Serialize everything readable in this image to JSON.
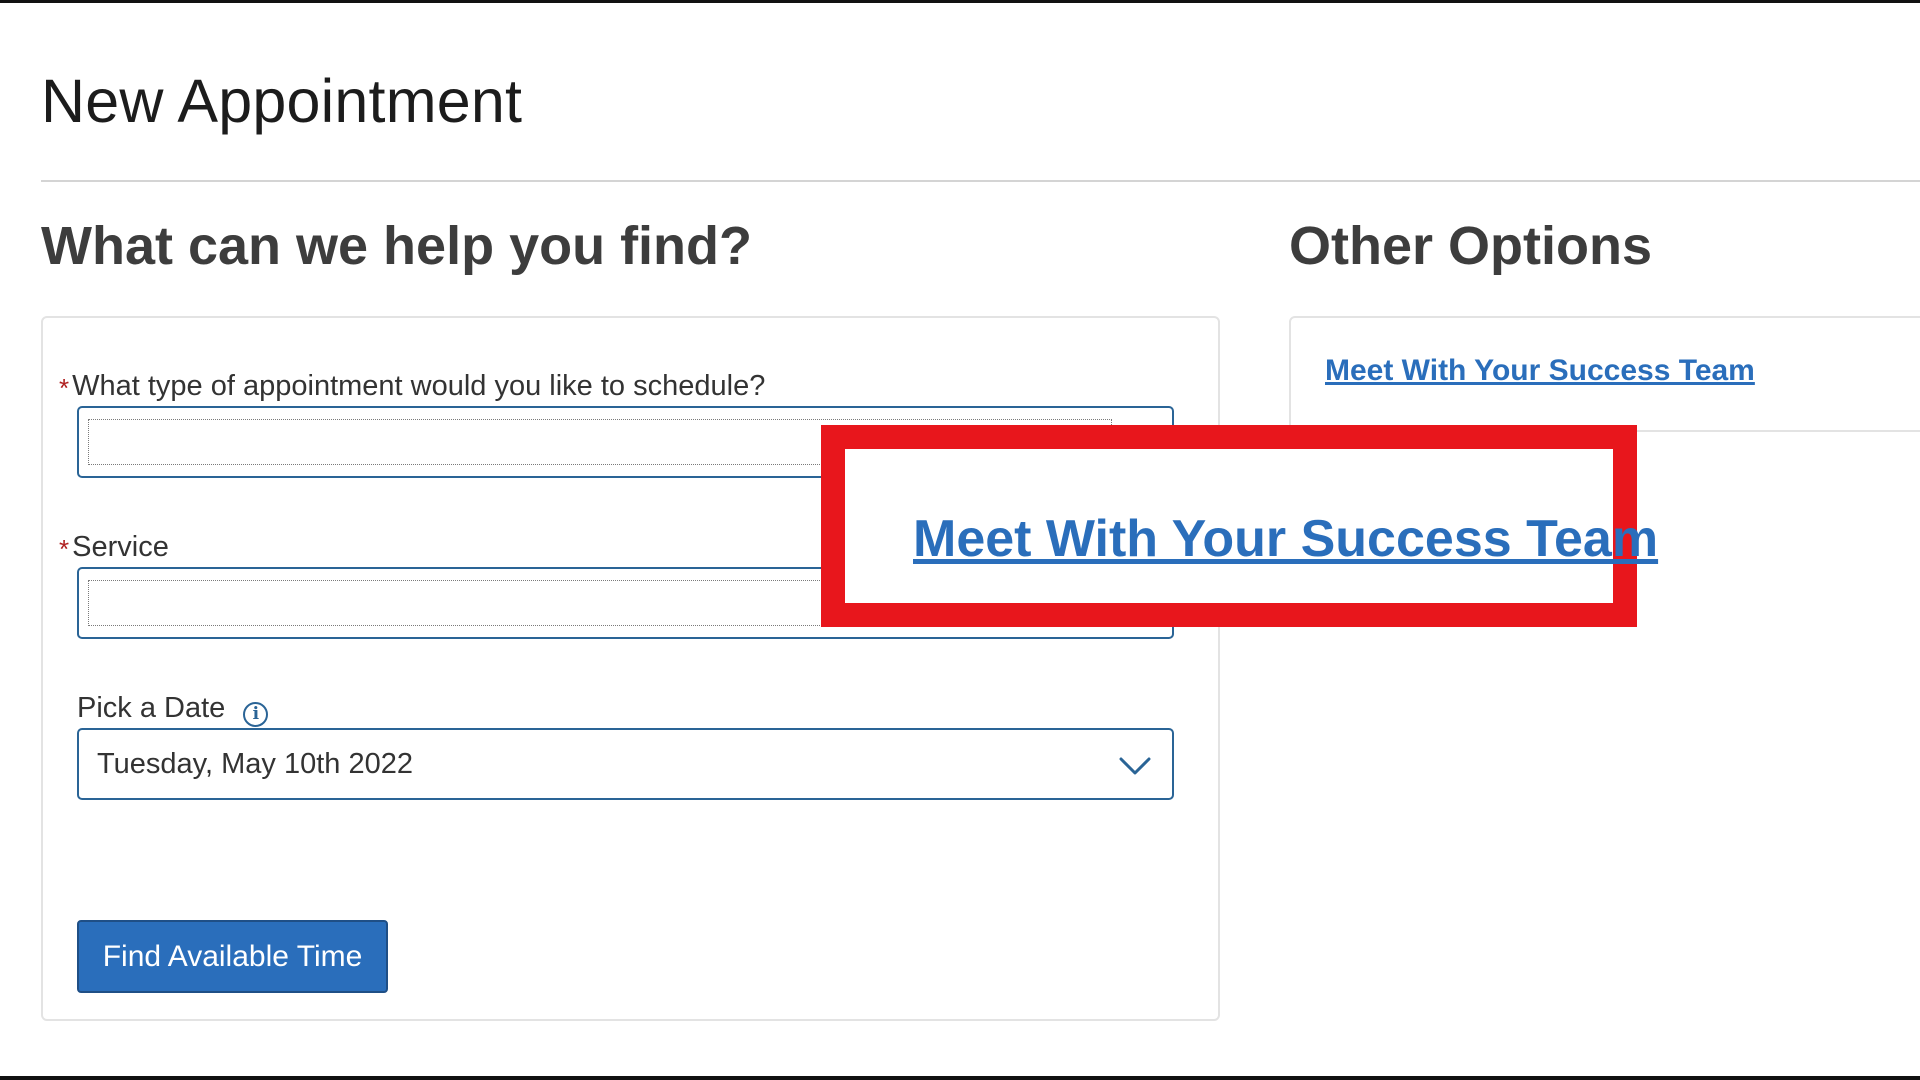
{
  "page": {
    "title": "New Appointment"
  },
  "form_section": {
    "heading": "What can we help you find?",
    "appointment_type": {
      "required_marker": "*",
      "label": "What type of appointment would you like to schedule?",
      "value": ""
    },
    "service": {
      "required_marker": "*",
      "label": "Service",
      "value": ""
    },
    "date": {
      "label": "Pick a Date",
      "info_icon": "info-icon",
      "info_glyph": "i",
      "value": "Tuesday, May 10th 2022",
      "dropdown_icon": "chevron-down-icon"
    },
    "submit_label": "Find Available Time"
  },
  "options_section": {
    "heading": "Other Options",
    "link_label": "Meet With Your Success Team"
  },
  "callout": {
    "link_label": "Meet With Your Success Team",
    "border_color": "#e8161c"
  },
  "colors": {
    "accent": "#2a6ebb",
    "field_border": "#2a6496",
    "required": "#b02020"
  }
}
